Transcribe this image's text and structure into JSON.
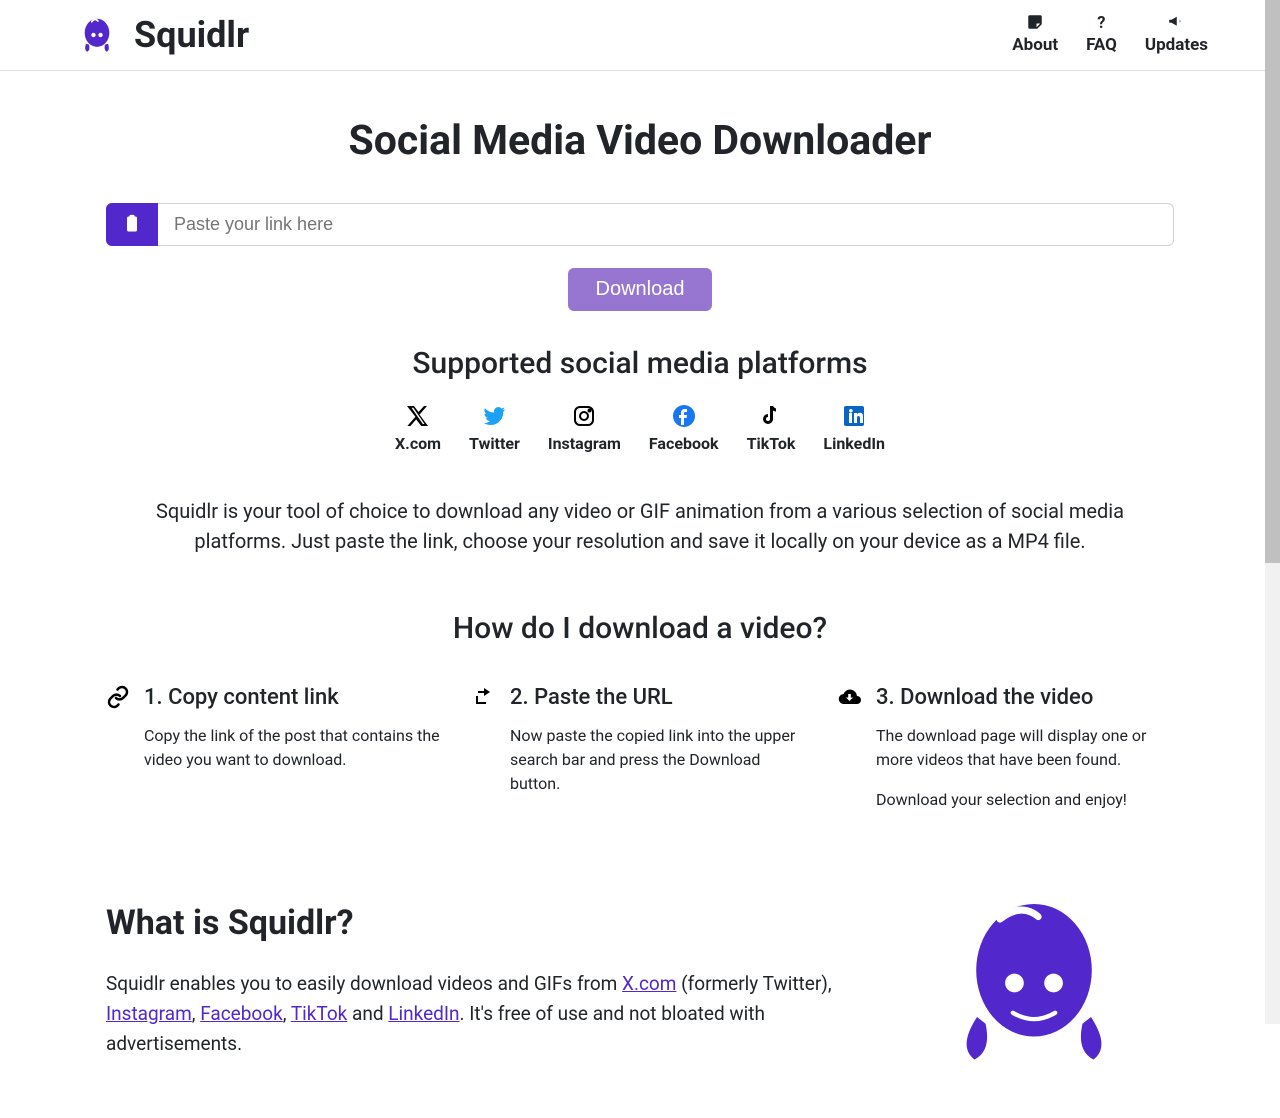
{
  "header": {
    "brand": "Squidlr",
    "nav": [
      {
        "label": "About"
      },
      {
        "label": "FAQ"
      },
      {
        "label": "Updates"
      }
    ]
  },
  "hero": {
    "title": "Social Media Video Downloader",
    "placeholder": "Paste your link here",
    "button": "Download"
  },
  "platforms": {
    "title": "Supported social media platforms",
    "items": [
      {
        "name": "X.com"
      },
      {
        "name": "Twitter"
      },
      {
        "name": "Instagram"
      },
      {
        "name": "Facebook"
      },
      {
        "name": "TikTok"
      },
      {
        "name": "LinkedIn"
      }
    ]
  },
  "description": "Squidlr is your tool of choice to download any video or GIF animation from a various selection of social media platforms. Just paste the link, choose your resolution and save it locally on your device as a MP4 file.",
  "howto": {
    "title": "How do I download a video?",
    "steps": [
      {
        "title": "1. Copy content link",
        "text": "Copy the link of the post that contains the video you want to download."
      },
      {
        "title": "2. Paste the URL",
        "text": "Now paste the copied link into the upper search bar and press the Download button."
      },
      {
        "title": "3. Download the video",
        "text1": "The download page will display one or more videos that have been found.",
        "text2": "Download your selection and enjoy!"
      }
    ]
  },
  "what": {
    "title": "What is Squidlr?",
    "intro1": "Squidlr enables you to easily download videos and GIFs from ",
    "link1": "X.com",
    "intro2": " (formerly Twitter), ",
    "link2": "Instagram",
    "intro3": ", ",
    "link3": "Facebook",
    "intro4": ", ",
    "link4": "TikTok",
    "intro5": " and ",
    "link5": "LinkedIn",
    "intro6": ". It's free of use and not bloated with advertisements."
  }
}
